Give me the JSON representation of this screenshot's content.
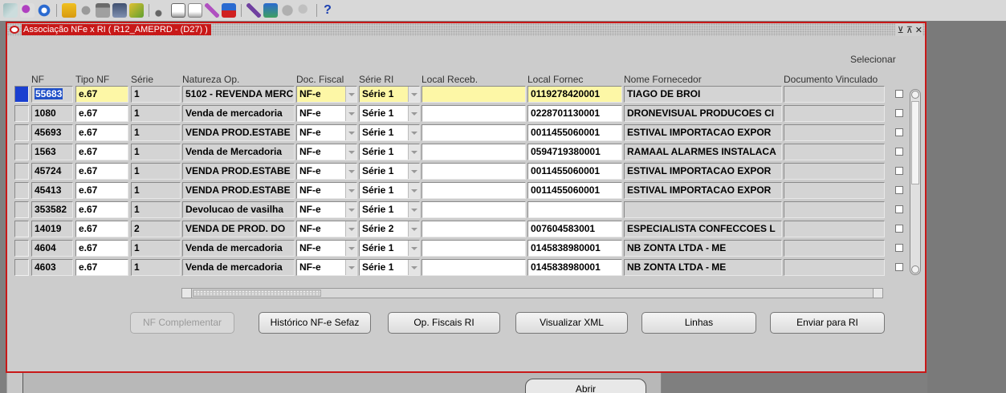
{
  "toolbar": {
    "icons": [
      "new-record-icon",
      "find-icon",
      "navigator-icon",
      "open-folder-icon",
      "save-icon",
      "print-icon",
      "close-form-icon",
      "attachments-icon",
      "cut-icon",
      "copy-icon",
      "paste-icon",
      "edit-icon",
      "clear-record-icon",
      "folder-tools-icon",
      "globe-icon",
      "translation-icon",
      "help-icon"
    ],
    "help_label": "?"
  },
  "window": {
    "title": "Associação NFe x RI ( R12_AMEPRD - (D27) )",
    "controls": [
      "⊻",
      "⊼",
      "✕"
    ]
  },
  "table": {
    "selecionar_label": "Selecionar",
    "headers": {
      "nf": "NF",
      "tipo_nf": "Tipo NF",
      "serie": "Série",
      "natureza": "Natureza Op.",
      "doc_fiscal": "Doc. Fiscal",
      "serie_ri": "Série RI",
      "local_receb": "Local Receb.",
      "local_fornec": "Local Fornec",
      "nome_fornecedor": "Nome Fornecedor",
      "documento_vinculado": "Documento Vinculado"
    },
    "rows": [
      {
        "nf": "55683",
        "tipo_nf": "e.67",
        "serie": "1",
        "natureza": "5102 - REVENDA MERC",
        "doc_fiscal": "NF-e",
        "serie_ri": "Série 1",
        "local_receb": "",
        "local_fornec": "0119278420001",
        "nome_fornecedor": "TIAGO DE BROI",
        "documento_vinculado": ""
      },
      {
        "nf": "1080",
        "tipo_nf": "e.67",
        "serie": "1",
        "natureza": "Venda de mercadoria",
        "doc_fiscal": "NF-e",
        "serie_ri": "Série 1",
        "local_receb": "",
        "local_fornec": "0228701130001",
        "nome_fornecedor": "DRONEVISUAL PRODUCOES CI",
        "documento_vinculado": ""
      },
      {
        "nf": "45693",
        "tipo_nf": "e.67",
        "serie": "1",
        "natureza": "VENDA PROD.ESTABE",
        "doc_fiscal": "NF-e",
        "serie_ri": "Série 1",
        "local_receb": "",
        "local_fornec": "0011455060001",
        "nome_fornecedor": "ESTIVAL IMPORTACAO EXPOR",
        "documento_vinculado": ""
      },
      {
        "nf": "1563",
        "tipo_nf": "e.67",
        "serie": "1",
        "natureza": "Venda de Mercadoria",
        "doc_fiscal": "NF-e",
        "serie_ri": "Série 1",
        "local_receb": "",
        "local_fornec": "0594719380001",
        "nome_fornecedor": "RAMAAL ALARMES INSTALACA",
        "documento_vinculado": ""
      },
      {
        "nf": "45724",
        "tipo_nf": "e.67",
        "serie": "1",
        "natureza": "VENDA PROD.ESTABE",
        "doc_fiscal": "NF-e",
        "serie_ri": "Série 1",
        "local_receb": "",
        "local_fornec": "0011455060001",
        "nome_fornecedor": "ESTIVAL IMPORTACAO EXPOR",
        "documento_vinculado": ""
      },
      {
        "nf": "45413",
        "tipo_nf": "e.67",
        "serie": "1",
        "natureza": "VENDA PROD.ESTABE",
        "doc_fiscal": "NF-e",
        "serie_ri": "Série 1",
        "local_receb": "",
        "local_fornec": "0011455060001",
        "nome_fornecedor": "ESTIVAL IMPORTACAO EXPOR",
        "documento_vinculado": ""
      },
      {
        "nf": "353582",
        "tipo_nf": "e.67",
        "serie": "1",
        "natureza": "Devolucao de vasilha",
        "doc_fiscal": "NF-e",
        "serie_ri": "Série 1",
        "local_receb": "",
        "local_fornec": "",
        "nome_fornecedor": "",
        "documento_vinculado": ""
      },
      {
        "nf": "14019",
        "tipo_nf": "e.67",
        "serie": "2",
        "natureza": "VENDA DE PROD. DO",
        "doc_fiscal": "NF-e",
        "serie_ri": "Série 2",
        "local_receb": "",
        "local_fornec": "007604583001",
        "nome_fornecedor": "ESPECIALISTA CONFECCOES L",
        "documento_vinculado": ""
      },
      {
        "nf": "4604",
        "tipo_nf": "e.67",
        "serie": "1",
        "natureza": "Venda de mercadoria",
        "doc_fiscal": "NF-e",
        "serie_ri": "Série 1",
        "local_receb": "",
        "local_fornec": "0145838980001",
        "nome_fornecedor": "NB ZONTA LTDA - ME",
        "documento_vinculado": ""
      },
      {
        "nf": "4603",
        "tipo_nf": "e.67",
        "serie": "1",
        "natureza": "Venda de mercadoria",
        "doc_fiscal": "NF-e",
        "serie_ri": "Série 1",
        "local_receb": "",
        "local_fornec": "0145838980001",
        "nome_fornecedor": "NB ZONTA LTDA - ME",
        "documento_vinculado": ""
      }
    ]
  },
  "buttons": {
    "nf_complementar": "NF Complementar",
    "historico": "Histórico NF-e Sefaz",
    "op_fiscais": "Op. Fiscais RI",
    "visualizar_xml": "Visualizar XML",
    "linhas": "Linhas",
    "enviar": "Enviar para RI"
  },
  "background": {
    "abrir_label": "Abrir"
  },
  "colors": {
    "window_border": "#c81818",
    "current_row_highlight": "#fdf7a6",
    "record_indicator": "#1a3fd0"
  }
}
